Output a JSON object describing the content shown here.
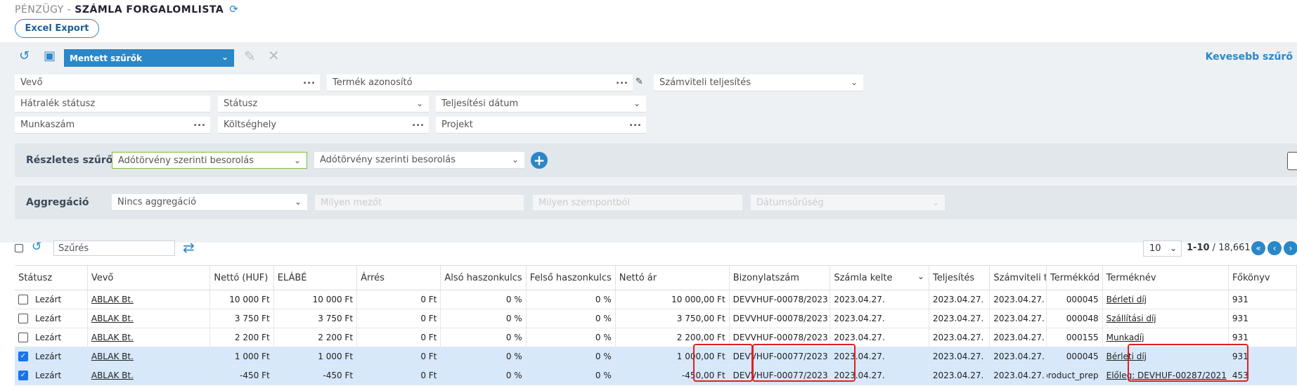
{
  "header": {
    "prefix": "PÉNZÜGY - ",
    "title": "SZÁMLA FORGALOMLISTA",
    "excel_export": "Excel Export"
  },
  "toolbar": {
    "saved_filters": "Mentett szűrők",
    "less_filters": "Kevesebb szűrő"
  },
  "filters": {
    "vevo": "Vevő",
    "termek_azonosito": "Termék azonosító",
    "szamviteli_teljesites": "Számviteli teljesítés",
    "hatralek_status": "Hátralék státusz",
    "status": "Státusz",
    "teljesitesi_datum": "Teljesítési dátum",
    "munkaszam": "Munkaszám",
    "koltseghely": "Költséghely",
    "projekt": "Projekt"
  },
  "detailed_filter": {
    "label": "Részletes szűrő",
    "field1": "Adótörvény szerinti besorolás",
    "field2": "Adótörvény szerinti besorolás"
  },
  "aggregation": {
    "label": "Aggregáció",
    "value": "Nincs aggregáció",
    "field_placeholder": "Milyen mezőt",
    "aspect_placeholder": "Milyen szempontból",
    "date_granularity": "Dátumsűrűség"
  },
  "list": {
    "search_placeholder": "Szűrés",
    "page_size": "10",
    "range": "1-10",
    "total": " / 18,661"
  },
  "table": {
    "columns": [
      "Státusz",
      "Vevő",
      "Nettó (HUF)",
      "ELÁBÉ",
      "Árrés",
      "Alsó haszonkulcs",
      "Felső haszonkulcs",
      "Nettó ár",
      "Bizonylatszám",
      "Számla kelte",
      "Teljesítés",
      "Számviteli te",
      "Termékkód",
      "Terméknév",
      "Főkönyv"
    ],
    "rows": [
      {
        "checked": false,
        "cells": [
          "Lezárt",
          "ABLAK Bt.",
          "10 000 Ft",
          "10 000 Ft",
          "0 Ft",
          "0 %",
          "0 %",
          "10 000,00 Ft",
          "DEVVHUF-00078/2023",
          "2023.04.27.",
          "2023.04.27.",
          "2023.04.27.",
          "000045",
          "Bérleti díj",
          "931"
        ]
      },
      {
        "checked": false,
        "cells": [
          "Lezárt",
          "ABLAK Bt.",
          "3 750 Ft",
          "3 750 Ft",
          "0 Ft",
          "0 %",
          "0 %",
          "3 750,00 Ft",
          "DEVVHUF-00078/2023",
          "2023.04.27.",
          "2023.04.27.",
          "2023.04.27.",
          "000048",
          "Szállítási díj",
          "931"
        ]
      },
      {
        "checked": false,
        "cells": [
          "Lezárt",
          "ABLAK Bt.",
          "2 200 Ft",
          "2 200 Ft",
          "0 Ft",
          "0 %",
          "0 %",
          "2 200,00 Ft",
          "DEVVHUF-00078/2023",
          "2023.04.27.",
          "2023.04.27.",
          "2023.04.27.",
          "000155",
          "Munkadíj",
          "931"
        ]
      },
      {
        "checked": true,
        "cells": [
          "Lezárt",
          "ABLAK Bt.",
          "1 000 Ft",
          "1 000 Ft",
          "0 Ft",
          "0 %",
          "0 %",
          "1 000,00 Ft",
          "DEVVHUF-00077/2023",
          "2023.04.27.",
          "2023.04.27.",
          "2023.04.27.",
          "000045",
          "Bérleti díj",
          "931"
        ]
      },
      {
        "checked": true,
        "cells": [
          "Lezárt",
          "ABLAK Bt.",
          "-450 Ft",
          "-450 Ft",
          "0 Ft",
          "0 %",
          "0 %",
          "-450,00 Ft",
          "DEVVHUF-00077/2023",
          "2023.04.27.",
          "2023.04.27.",
          "2023.04.27.",
          "product_prep",
          "Előleg: DEVHUF-00287/2021",
          "453"
        ]
      }
    ]
  },
  "colors": {
    "accent": "#2a87c8",
    "selected_row": "#d7e8fb",
    "highlight": "#e02020"
  }
}
